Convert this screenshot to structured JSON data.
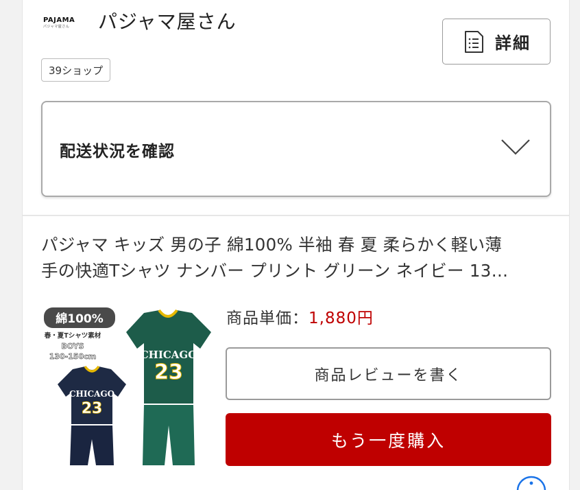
{
  "shop": {
    "logo_text": "PAJAMA",
    "logo_subtext": "パジャマ屋さん",
    "name": "パジャマ屋さん",
    "tag": "39ショップ",
    "detail_button_label": "詳細",
    "detail_icon": "document-list-icon"
  },
  "shipping": {
    "label": "配送状況を確認",
    "icon": "chevron-down-icon"
  },
  "product": {
    "title_line1": "パジャマ キッズ 男の子 綿100% 半袖 春 夏 柔らかく軽い薄",
    "title_line2": "手の快適Tシャツ ナンバー プリント グリーン ネイビー 13…",
    "image": {
      "badge": "綿100%",
      "caption1": "春・夏Tシャツ素材",
      "caption2": "BOYS",
      "caption3": "130-150cm",
      "shirt_text": "CHICAGO",
      "shirt_number": "23"
    },
    "price_label": "商品単価：",
    "price_value": "1,880円",
    "review_button_label": "商品レビューを書く",
    "rebuy_button_label": "もう一度購入"
  },
  "colors": {
    "accent_red": "#bf0000",
    "info_blue": "#1a73e8",
    "shirt_green": "#1d5c4a",
    "shirt_navy": "#1e2a44"
  }
}
